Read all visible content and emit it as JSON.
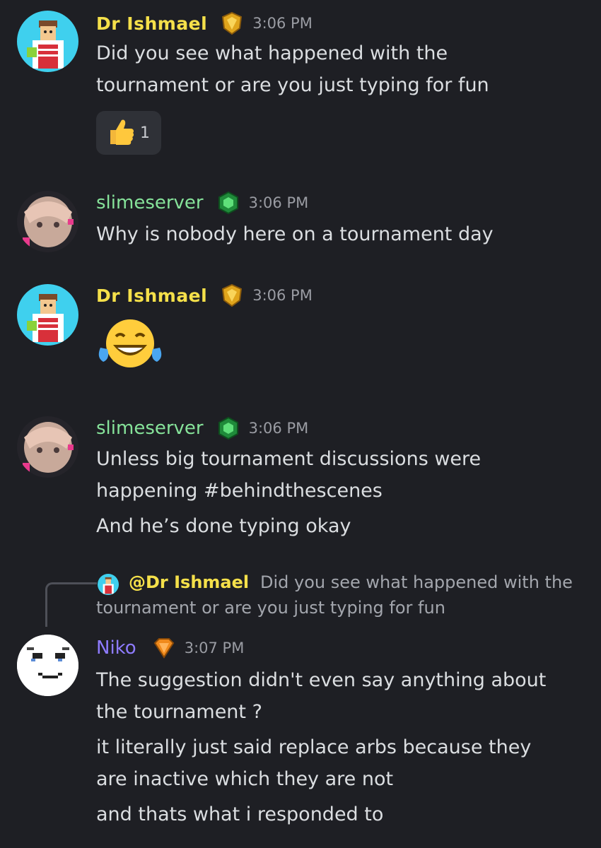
{
  "messages": [
    {
      "username": "Dr Ishmael",
      "time": "3:06 PM",
      "lines": [
        "Did you see what happened with the",
        "tournament or are you just typing for fun"
      ],
      "reaction": {
        "emoji": "thumbs-up",
        "count": "1"
      }
    },
    {
      "username": "slimeserver",
      "time": "3:06 PM",
      "lines": [
        "Why is nobody here on a tournament day"
      ]
    },
    {
      "username": "Dr Ishmael",
      "time": "3:06 PM",
      "emoji": "face-with-tears-of-joy"
    },
    {
      "username": "slimeserver",
      "time": "3:06 PM",
      "lines": [
        "Unless big tournament discussions were",
        "happening #behindthescenes",
        "And he’s done typing okay"
      ]
    },
    {
      "reply": {
        "mention": "@Dr Ishmael",
        "text_line1": "Did you see what happened with the",
        "text_line2": "tournament or are you just typing for fun"
      },
      "username": "Niko",
      "time": "3:07 PM",
      "lines": [
        "The suggestion didn't even say anything about",
        "the tournament ?",
        "it literally just said replace arbs because they",
        "are inactive which they are not",
        "and thats what i responded to"
      ]
    }
  ],
  "colors": {
    "background": "#1e1f24",
    "ishmael_name": "#f5e04a",
    "slime_name": "#86e39a",
    "niko_name": "#8e7bff",
    "timestamp": "#9a9ca3"
  },
  "icons": [
    "gold-shield-badge-icon",
    "green-gem-badge-icon",
    "orange-diamond-badge-icon"
  ]
}
